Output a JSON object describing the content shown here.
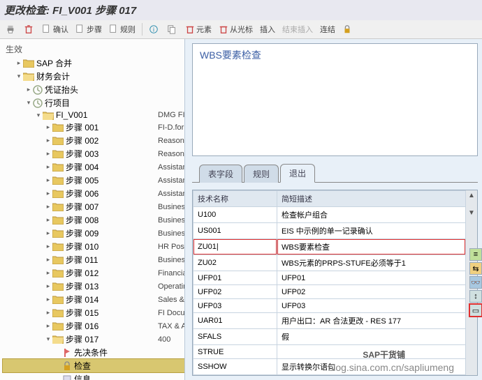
{
  "title": "更改检查:   FI_V001 步骤 017",
  "toolbar": {
    "confirm": "确认",
    "step": "步骤",
    "rule": "规则",
    "element": "元素",
    "from_cursor": "从光标",
    "insert": "插入",
    "end_insert": "结束插入",
    "link": "连结"
  },
  "left_header": "生效",
  "tree": {
    "sap_merge": "SAP 合并",
    "fin_acct": "财务会计",
    "voucher_head": "凭证抬头",
    "line_item": "行项目",
    "fi_v001": "FI_V001",
    "fiv001_desc": "DMG FI I",
    "steps": [
      {
        "label": "步骤 001",
        "desc": "FI-D.for"
      },
      {
        "label": "步骤 002",
        "desc": "Reason C"
      },
      {
        "label": "步骤 003",
        "desc": "Reason C"
      },
      {
        "label": "步骤 004",
        "desc": "Assistant"
      },
      {
        "label": "步骤 005",
        "desc": "Assistant"
      },
      {
        "label": "步骤 006",
        "desc": "Assistant"
      },
      {
        "label": "步骤 007",
        "desc": "Business"
      },
      {
        "label": "步骤 008",
        "desc": "Business"
      },
      {
        "label": "步骤 009",
        "desc": "Business"
      },
      {
        "label": "步骤 010",
        "desc": "HR Postir"
      },
      {
        "label": "步骤 011",
        "desc": "Business"
      },
      {
        "label": "步骤 012",
        "desc": "Financial I"
      },
      {
        "label": "步骤 013",
        "desc": "Operating"
      },
      {
        "label": "步骤 014",
        "desc": "Sales & M"
      },
      {
        "label": "步骤 015",
        "desc": "FI Docum"
      },
      {
        "label": "步骤 016",
        "desc": "TAX & A"
      }
    ],
    "step017": "步骤 017",
    "step017_desc": "400",
    "prereq": "先决条件",
    "check": "检查",
    "info": "信息"
  },
  "right": {
    "desc_title": "WBS要素检查",
    "tabs": {
      "fields": "表字段",
      "rules": "规则",
      "exit": "退出"
    },
    "grid_headers": {
      "tech": "技术名称",
      "short": "简短描述"
    },
    "grid_rows": [
      {
        "tech": "U100",
        "short": "检查帐户组合"
      },
      {
        "tech": "US001",
        "short": "EIS 中示例的单一记录确认"
      },
      {
        "tech": "ZU01",
        "short": "WBS要素检查"
      },
      {
        "tech": "ZU02",
        "short": "WBS元素的PRPS-STUFE必须等于1"
      },
      {
        "tech": "UFP01",
        "short": "UFP01"
      },
      {
        "tech": "UFP02",
        "short": "UFP02"
      },
      {
        "tech": "UFP03",
        "short": "UFP03"
      },
      {
        "tech": "UAR01",
        "short": "用户出口：AR 合法更改 - RES 177"
      },
      {
        "tech": "SFALS",
        "short": "假"
      },
      {
        "tech": "STRUE",
        "short": ""
      },
      {
        "tech": "SSHOW",
        "short": "显示转换尔语句"
      }
    ]
  },
  "wm_brand": "SAP干货铺",
  "watermark": "blog.sina.com.cn/sapliumeng"
}
